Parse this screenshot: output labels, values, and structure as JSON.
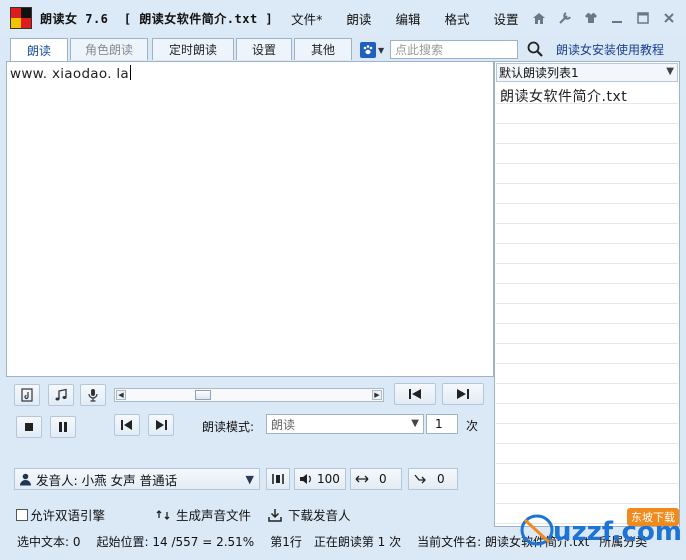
{
  "window": {
    "app_title": "朗读女 7.6  [ 朗读女软件简介.txt ]",
    "menu": [
      "文件*",
      "朗读",
      "编辑",
      "格式",
      "设置"
    ]
  },
  "tabs": [
    {
      "label": "朗读",
      "state": "active"
    },
    {
      "label": "角色朗读",
      "state": "disabled"
    },
    {
      "label": "定时朗读",
      "state": "normal"
    },
    {
      "label": "设置",
      "state": "normal"
    },
    {
      "label": "其他",
      "state": "normal"
    }
  ],
  "search": {
    "placeholder": "点此搜索"
  },
  "help_link": "朗读女安装使用教程",
  "editor": {
    "text": "www. xiaodao. la"
  },
  "playlist": {
    "selected": "默认朗读列表1",
    "items": [
      "朗读女软件简介.txt"
    ]
  },
  "controls": {
    "mode_label": "朗读模式:",
    "mode_value": "朗读",
    "repeat_count": "1",
    "repeat_unit": "次",
    "voice": "发音人: 小燕 女声 普通话",
    "volume": "100",
    "speed": "0",
    "pitch": "0",
    "bilingual_label": "允许双语引擎",
    "bilingual_checked": false,
    "generate_label": "生成声音文件",
    "download_label": "下载发音人"
  },
  "status": {
    "selected_text": "选中文本: 0",
    "start_pos": "起始位置: 14 /557 = 2.51%",
    "line": "第1行",
    "reading": "正在朗读第 1 次",
    "current_file": "当前文件名: 朗读女软件简介.txt",
    "category": "所属分类"
  },
  "watermark": {
    "text": "uzzf.com",
    "badge": "东坡下载"
  },
  "colors": {
    "accent": "#1b4fa0",
    "frame": "#dbe9f7",
    "border": "#9fb3c8"
  }
}
